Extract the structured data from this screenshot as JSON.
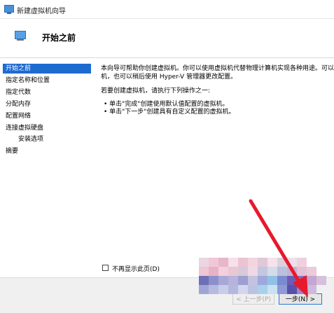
{
  "window": {
    "title": "新建虚拟机向导"
  },
  "header": {
    "title": "开始之前"
  },
  "sidebar": {
    "items": [
      {
        "label": "开始之前",
        "active": true
      },
      {
        "label": "指定名称和位置"
      },
      {
        "label": "指定代数"
      },
      {
        "label": "分配内存"
      },
      {
        "label": "配置网络"
      },
      {
        "label": "连接虚拟硬盘"
      },
      {
        "label": "安装选项",
        "sub": true
      },
      {
        "label": "摘要"
      }
    ]
  },
  "content": {
    "intro_line1": "本向导可帮助你创建虚拟机。你可以使用虚拟机代替物理计算机实现各种用途。可以",
    "intro_line2": "机，也可以稍后使用 Hyper-V 管理器更改配置。",
    "instruction": "若要创建虚拟机，请执行下列操作之一:",
    "bullets": [
      "• 单击\"完成\"创建使用默认值配置的虚拟机。",
      "• 单击\"下一步\"创建具有自定义配置的虚拟机。"
    ]
  },
  "checkbox": {
    "label": "不再显示此页(D)",
    "checked": false
  },
  "footer": {
    "prev_label": "< 上一步(P)",
    "next_label": "一步(N) >"
  },
  "colors": {
    "accent": "#1e6bd0",
    "arrow": "#e8192c"
  }
}
